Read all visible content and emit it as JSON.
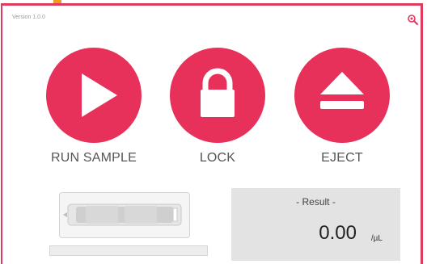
{
  "app": {
    "version": "Version 1.0.0"
  },
  "toolbar": {
    "settings_icon": "settings-gear-icon"
  },
  "actions": [
    {
      "label": "RUN SAMPLE",
      "icon": "play-icon"
    },
    {
      "label": "LOCK",
      "icon": "lock-icon"
    },
    {
      "label": "EJECT",
      "icon": "eject-icon"
    }
  ],
  "cartridge": {
    "icon": "cartridge-icon"
  },
  "progress": {
    "value": 0
  },
  "result": {
    "title": "- Result -",
    "value": "0.00",
    "unit": "/µL"
  },
  "colors": {
    "accent": "#e8315a",
    "frame": "#e03a5c",
    "panel": "#e3e3e3"
  }
}
